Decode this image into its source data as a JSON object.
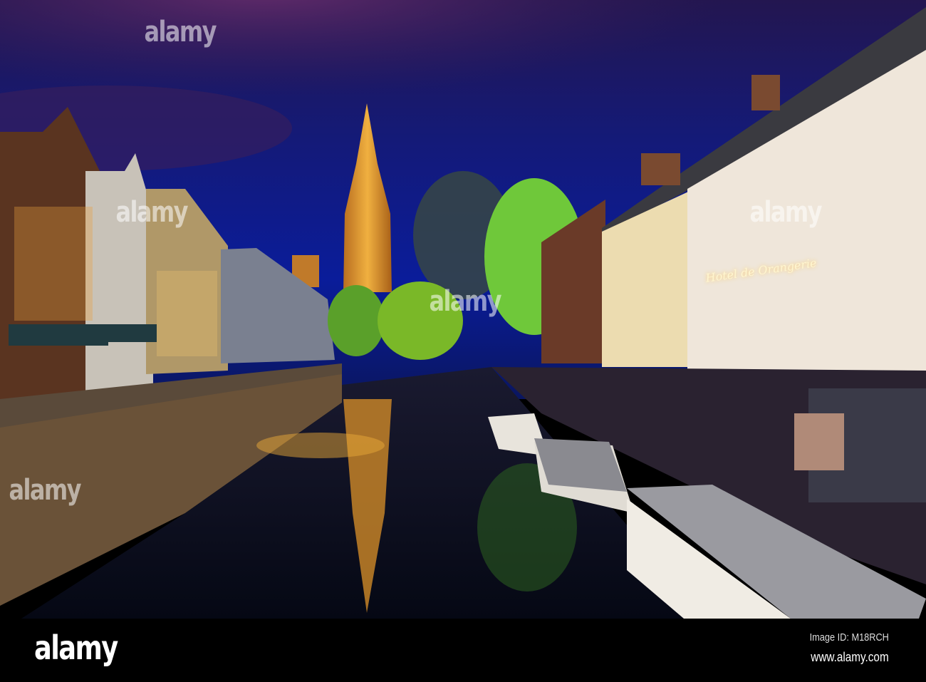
{
  "photo": {
    "subject": "canal-night-scene",
    "sign_text": "Hotel de Orangerie",
    "colors": {
      "sky_top": "#1a1450",
      "sky_mid": "#0c1a8a",
      "cloud": "#5a2a6a",
      "tower": "#e09a30",
      "water": "#0a0e24",
      "foliage": "#6fc83a"
    }
  },
  "watermark": {
    "text": "alamy"
  },
  "banner": {
    "logo": "alamy",
    "image_id": "Image ID: M18RCH",
    "url": "www.alamy.com"
  }
}
